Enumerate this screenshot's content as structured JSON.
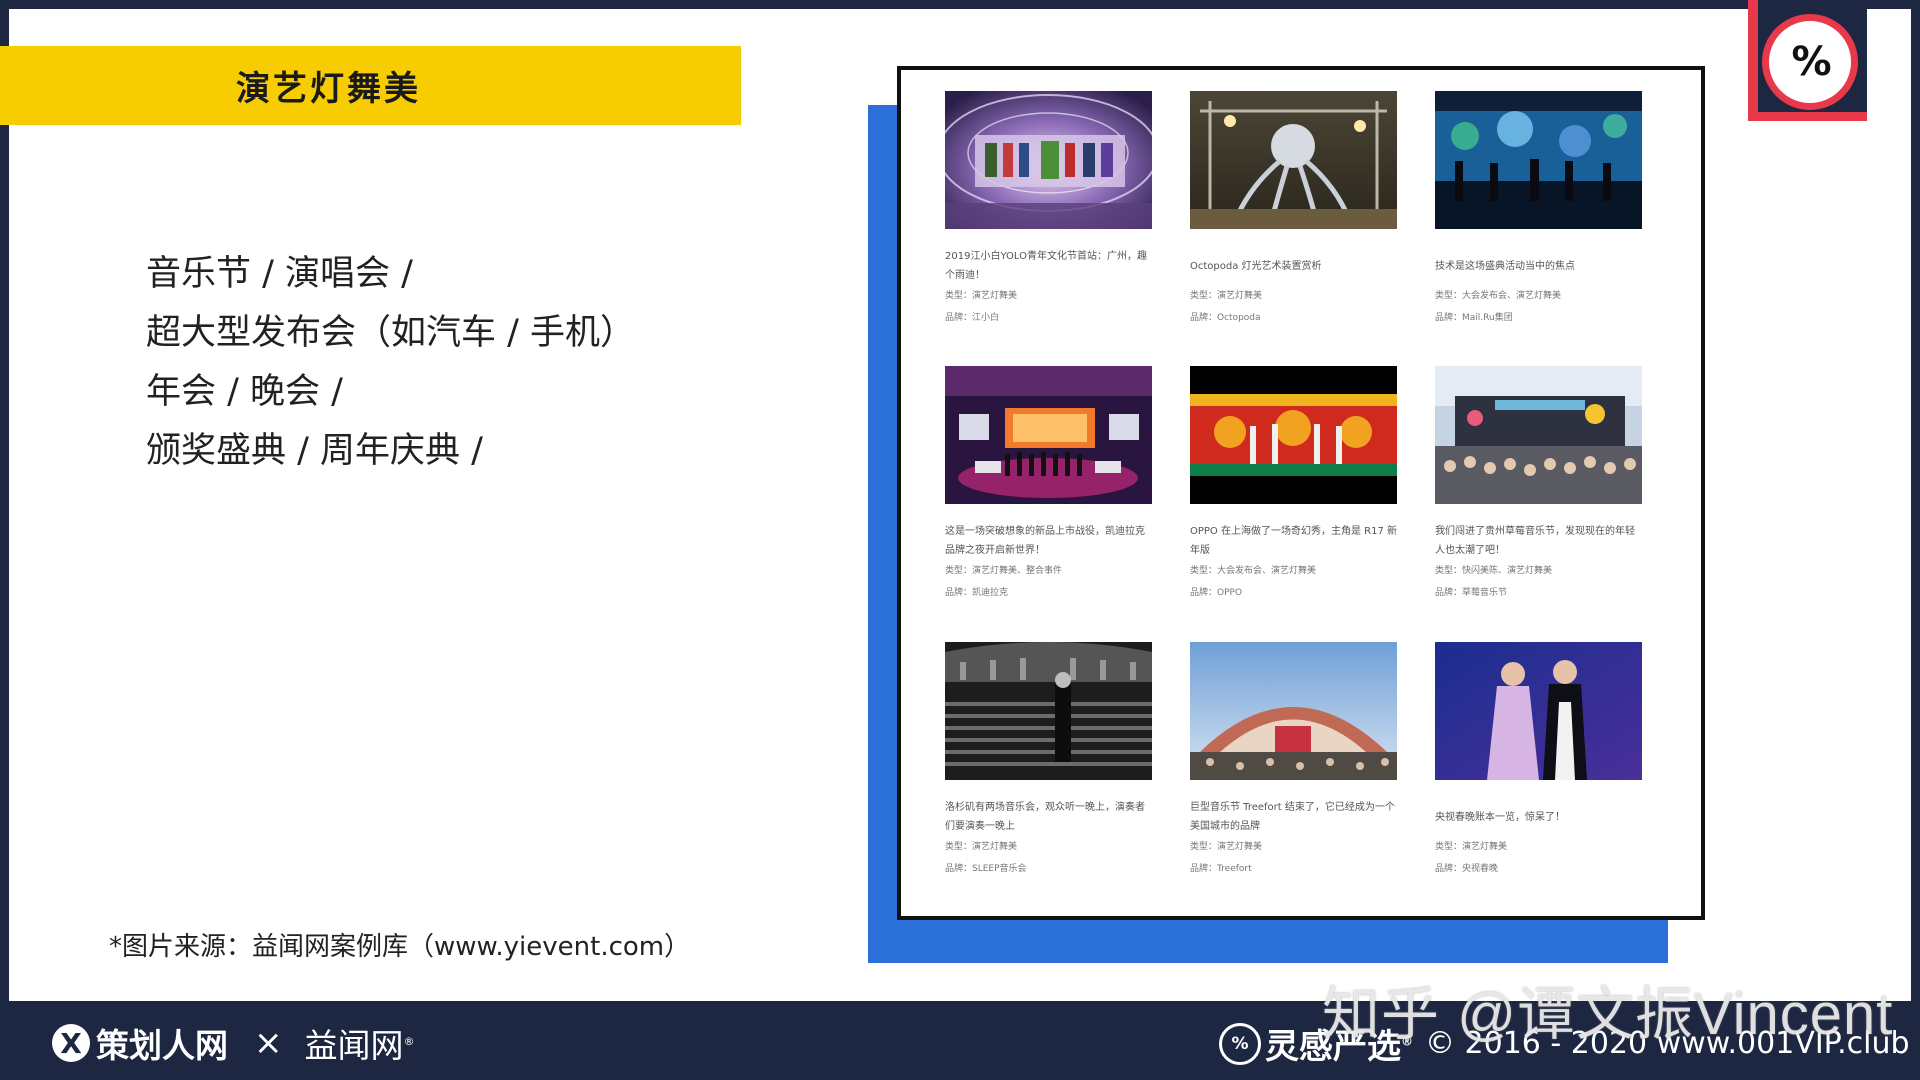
{
  "slide": {
    "title": "演艺灯舞美",
    "bullets": [
      "音乐节 / 演唱会 /",
      "超大型发布会（如汽车 / 手机）",
      "年会 / 晚会 /",
      "颁奖盛典 / 周年庆典 /"
    ],
    "source": "*图片来源：益闻网案例库（www.yievent.com）"
  },
  "cases": [
    {
      "caption": "2019江小白YOLO青年文化节首站：广州，趣个雨迪！",
      "type": "类型：演艺灯舞美",
      "brand": "品牌：江小白"
    },
    {
      "caption": "Octopoda 灯光艺术装置赏析",
      "type": "类型：演艺灯舞美",
      "brand": "品牌：Octopoda"
    },
    {
      "caption": "技术是这场盛典活动当中的焦点",
      "type": "类型：大会发布会、演艺灯舞美",
      "brand": "品牌：Mail.Ru集团"
    },
    {
      "caption": "这是一场突破想象的新品上市战役，凯迪拉克品牌之夜开启新世界！",
      "type": "类型：演艺灯舞美、整合事件",
      "brand": "品牌：凯迪拉克"
    },
    {
      "caption": "OPPO 在上海做了一场奇幻秀，主角是 R17 新年版",
      "type": "类型：大会发布会、演艺灯舞美",
      "brand": "品牌：OPPO"
    },
    {
      "caption": "我们闯进了贵州草莓音乐节，发现现在的年轻人也太潮了吧！",
      "type": "类型：快闪美陈、演艺灯舞美",
      "brand": "品牌：草莓音乐节"
    },
    {
      "caption": "洛杉矶有两场音乐会，观众听一晚上，演奏者们要演奏一晚上",
      "type": "类型：演艺灯舞美",
      "brand": "品牌：SLEEP音乐会"
    },
    {
      "caption": "巨型音乐节 Treefort 结束了，它已经成为一个美国城市的品牌",
      "type": "类型：演艺灯舞美",
      "brand": "品牌：Treefort"
    },
    {
      "caption": "央视春晚账本一览，惊呆了！",
      "type": "类型：演艺灯舞美",
      "brand": "品牌：央视春晚"
    }
  ],
  "logo": {
    "mark": "%"
  },
  "footer": {
    "left_brand": "策划人网",
    "left_icon": "X",
    "times": "×",
    "partner": "益闻网",
    "reg": "®",
    "right_brand": "灵感严选",
    "right_icon": "%",
    "copyright": "© 2016 - 2020 www.001VIP.club"
  },
  "watermark": "知乎 @谭文振Vincent",
  "colors": {
    "navy": "#1e2742",
    "yellow": "#f7cc00",
    "blue": "#2b6fd9",
    "red": "#e8394a"
  }
}
